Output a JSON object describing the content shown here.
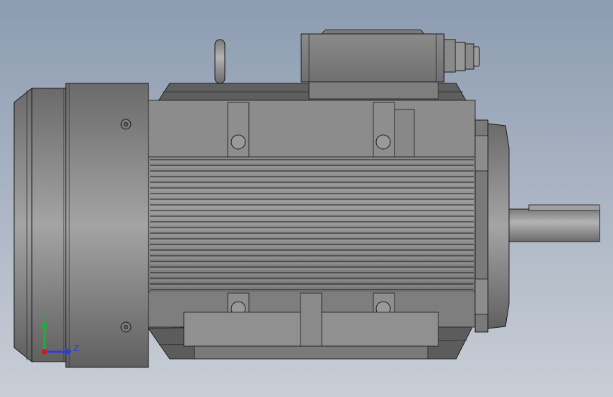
{
  "viewport": {
    "title": "",
    "background_top": "#8c9cb1",
    "background_bottom": "#c9ced6"
  },
  "model": {
    "name": "",
    "body_color": "#8a8a8a",
    "edge_color": "#1a1a1a"
  },
  "triad": {
    "y_label": "Y",
    "z_label": "Z",
    "y_color": "#1fae3a",
    "z_color": "#2b3fd6",
    "x_color": "#c81e1e"
  }
}
